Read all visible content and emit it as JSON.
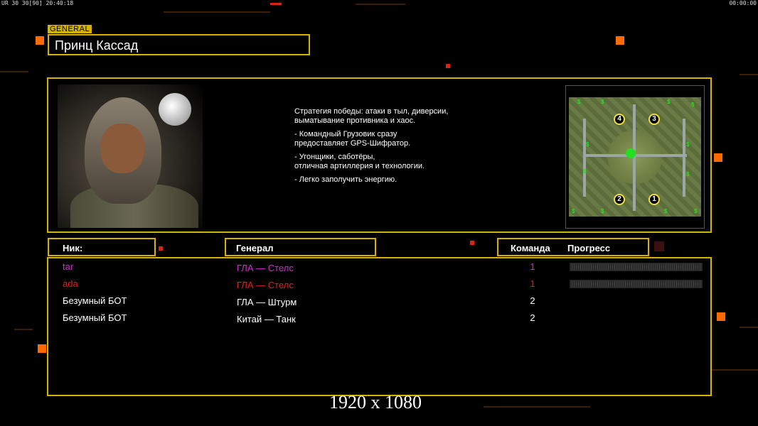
{
  "hud": {
    "left": "UR 30 30[90] 20:40:18",
    "right": "00:00:00"
  },
  "general_tag": "GENERAL",
  "general_name": "Принц Кассад",
  "strategy_lines": [
    "Стратегия победы: атаки в тыл, диверсии,\nвыматывание противника и хаос.",
    "- Командный Грузовик сразу\nпредоставляет GPS-Шифратор.",
    "- Угонщики, саботёры,\nотличная артиллерия и технологии.",
    "- Легко заполучить энергию."
  ],
  "minimap": {
    "spawns": [
      "4",
      "3",
      "2",
      "1"
    ],
    "supply_icon": "dollar-icon"
  },
  "headers": {
    "nick": "Ник:",
    "general": "Генерал",
    "team": "Команда",
    "progress": "Прогресс"
  },
  "players": [
    {
      "nick": "tar",
      "general": "ГЛА — Стелс",
      "team": "1",
      "color": "#d428d4",
      "has_progress": true
    },
    {
      "nick": "ada",
      "general": "ГЛА — Стелс",
      "team": "1",
      "color": "#e81c1c",
      "has_progress": true
    },
    {
      "nick": "Безумный БОТ",
      "general": "ГЛА — Штурм",
      "team": "2",
      "color": "#ffffff",
      "has_progress": false
    },
    {
      "nick": "Безумный БОТ",
      "general": "Китай — Танк",
      "team": "2",
      "color": "#ffffff",
      "has_progress": false
    }
  ],
  "resolution_caption": "1920 x 1080",
  "colors": {
    "frame": "#d4b400",
    "accent_orange": "#ff6a00",
    "background": "#000000"
  }
}
